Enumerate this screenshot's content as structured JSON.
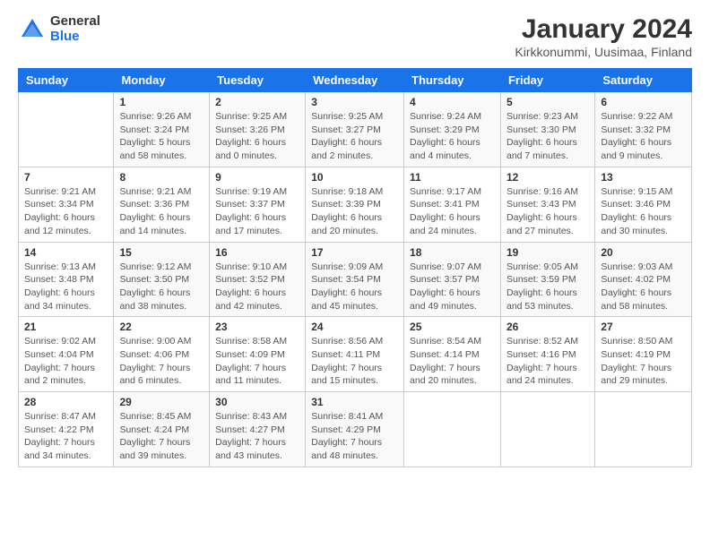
{
  "header": {
    "logo_general": "General",
    "logo_blue": "Blue",
    "main_title": "January 2024",
    "subtitle": "Kirkkonummi, Uusimaa, Finland"
  },
  "weekdays": [
    "Sunday",
    "Monday",
    "Tuesday",
    "Wednesday",
    "Thursday",
    "Friday",
    "Saturday"
  ],
  "weeks": [
    [
      {
        "num": "",
        "detail": ""
      },
      {
        "num": "1",
        "detail": "Sunrise: 9:26 AM\nSunset: 3:24 PM\nDaylight: 5 hours\nand 58 minutes."
      },
      {
        "num": "2",
        "detail": "Sunrise: 9:25 AM\nSunset: 3:26 PM\nDaylight: 6 hours\nand 0 minutes."
      },
      {
        "num": "3",
        "detail": "Sunrise: 9:25 AM\nSunset: 3:27 PM\nDaylight: 6 hours\nand 2 minutes."
      },
      {
        "num": "4",
        "detail": "Sunrise: 9:24 AM\nSunset: 3:29 PM\nDaylight: 6 hours\nand 4 minutes."
      },
      {
        "num": "5",
        "detail": "Sunrise: 9:23 AM\nSunset: 3:30 PM\nDaylight: 6 hours\nand 7 minutes."
      },
      {
        "num": "6",
        "detail": "Sunrise: 9:22 AM\nSunset: 3:32 PM\nDaylight: 6 hours\nand 9 minutes."
      }
    ],
    [
      {
        "num": "7",
        "detail": "Sunrise: 9:21 AM\nSunset: 3:34 PM\nDaylight: 6 hours\nand 12 minutes."
      },
      {
        "num": "8",
        "detail": "Sunrise: 9:21 AM\nSunset: 3:36 PM\nDaylight: 6 hours\nand 14 minutes."
      },
      {
        "num": "9",
        "detail": "Sunrise: 9:19 AM\nSunset: 3:37 PM\nDaylight: 6 hours\nand 17 minutes."
      },
      {
        "num": "10",
        "detail": "Sunrise: 9:18 AM\nSunset: 3:39 PM\nDaylight: 6 hours\nand 20 minutes."
      },
      {
        "num": "11",
        "detail": "Sunrise: 9:17 AM\nSunset: 3:41 PM\nDaylight: 6 hours\nand 24 minutes."
      },
      {
        "num": "12",
        "detail": "Sunrise: 9:16 AM\nSunset: 3:43 PM\nDaylight: 6 hours\nand 27 minutes."
      },
      {
        "num": "13",
        "detail": "Sunrise: 9:15 AM\nSunset: 3:46 PM\nDaylight: 6 hours\nand 30 minutes."
      }
    ],
    [
      {
        "num": "14",
        "detail": "Sunrise: 9:13 AM\nSunset: 3:48 PM\nDaylight: 6 hours\nand 34 minutes."
      },
      {
        "num": "15",
        "detail": "Sunrise: 9:12 AM\nSunset: 3:50 PM\nDaylight: 6 hours\nand 38 minutes."
      },
      {
        "num": "16",
        "detail": "Sunrise: 9:10 AM\nSunset: 3:52 PM\nDaylight: 6 hours\nand 42 minutes."
      },
      {
        "num": "17",
        "detail": "Sunrise: 9:09 AM\nSunset: 3:54 PM\nDaylight: 6 hours\nand 45 minutes."
      },
      {
        "num": "18",
        "detail": "Sunrise: 9:07 AM\nSunset: 3:57 PM\nDaylight: 6 hours\nand 49 minutes."
      },
      {
        "num": "19",
        "detail": "Sunrise: 9:05 AM\nSunset: 3:59 PM\nDaylight: 6 hours\nand 53 minutes."
      },
      {
        "num": "20",
        "detail": "Sunrise: 9:03 AM\nSunset: 4:02 PM\nDaylight: 6 hours\nand 58 minutes."
      }
    ],
    [
      {
        "num": "21",
        "detail": "Sunrise: 9:02 AM\nSunset: 4:04 PM\nDaylight: 7 hours\nand 2 minutes."
      },
      {
        "num": "22",
        "detail": "Sunrise: 9:00 AM\nSunset: 4:06 PM\nDaylight: 7 hours\nand 6 minutes."
      },
      {
        "num": "23",
        "detail": "Sunrise: 8:58 AM\nSunset: 4:09 PM\nDaylight: 7 hours\nand 11 minutes."
      },
      {
        "num": "24",
        "detail": "Sunrise: 8:56 AM\nSunset: 4:11 PM\nDaylight: 7 hours\nand 15 minutes."
      },
      {
        "num": "25",
        "detail": "Sunrise: 8:54 AM\nSunset: 4:14 PM\nDaylight: 7 hours\nand 20 minutes."
      },
      {
        "num": "26",
        "detail": "Sunrise: 8:52 AM\nSunset: 4:16 PM\nDaylight: 7 hours\nand 24 minutes."
      },
      {
        "num": "27",
        "detail": "Sunrise: 8:50 AM\nSunset: 4:19 PM\nDaylight: 7 hours\nand 29 minutes."
      }
    ],
    [
      {
        "num": "28",
        "detail": "Sunrise: 8:47 AM\nSunset: 4:22 PM\nDaylight: 7 hours\nand 34 minutes."
      },
      {
        "num": "29",
        "detail": "Sunrise: 8:45 AM\nSunset: 4:24 PM\nDaylight: 7 hours\nand 39 minutes."
      },
      {
        "num": "30",
        "detail": "Sunrise: 8:43 AM\nSunset: 4:27 PM\nDaylight: 7 hours\nand 43 minutes."
      },
      {
        "num": "31",
        "detail": "Sunrise: 8:41 AM\nSunset: 4:29 PM\nDaylight: 7 hours\nand 48 minutes."
      },
      {
        "num": "",
        "detail": ""
      },
      {
        "num": "",
        "detail": ""
      },
      {
        "num": "",
        "detail": ""
      }
    ]
  ]
}
